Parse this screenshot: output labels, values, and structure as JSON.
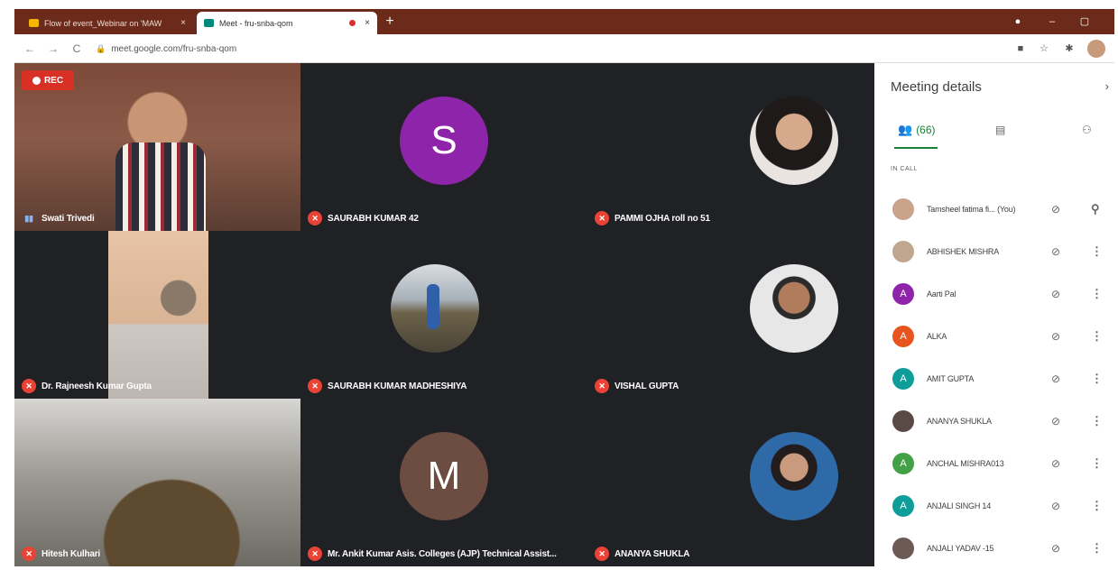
{
  "browser": {
    "tabs": [
      {
        "label": "Flow of event_Webinar on 'MAW",
        "active": false
      },
      {
        "label": "Meet - fru-snba-qom",
        "active": true
      }
    ],
    "tab_close": "×",
    "new_tab": "+",
    "url": "meet.google.com/fru-snba-qom",
    "nav": {
      "back": "←",
      "forward": "→",
      "reload": "C"
    },
    "window": {
      "minimize": "–",
      "maximize": "▢"
    },
    "toolbar_icons": [
      "camera-icon",
      "star-icon",
      "extensions-icon"
    ]
  },
  "meet": {
    "recording_label": "REC",
    "tiles": [
      {
        "name": "Swati Trivedi",
        "kind": "video",
        "muted": false
      },
      {
        "name": "SAURABH KUMAR 42",
        "kind": "letter",
        "letter": "S",
        "color": "#8e24aa",
        "muted": true
      },
      {
        "name": "PAMMI OJHA roll no 51",
        "kind": "photo",
        "muted": true
      },
      {
        "name": "Dr. Rajneesh Kumar Gupta",
        "kind": "video",
        "muted": true
      },
      {
        "name": "SAURABH KUMAR MADHESHIYA",
        "kind": "photo",
        "muted": true
      },
      {
        "name": "VISHAL GUPTA",
        "kind": "photo",
        "muted": true
      },
      {
        "name": "Hitesh Kulhari",
        "kind": "video",
        "muted": true
      },
      {
        "name": "Mr. Ankit Kumar Asis. Colleges (AJP) Technical Assist...",
        "kind": "letter",
        "letter": "M",
        "color": "#6d4c41",
        "muted": true
      },
      {
        "name": "ANANYA SHUKLA",
        "kind": "photo",
        "muted": true
      }
    ]
  },
  "panel": {
    "title": "Meeting details",
    "close": "›",
    "people_tab_label": "(66)",
    "in_call_label": "IN CALL",
    "participants": [
      {
        "name": "Tamsheel fatima fi... (You)",
        "avatar": "photo",
        "color": "#c9a28a",
        "letter": "",
        "action": "pin"
      },
      {
        "name": "ABHISHEK MISHRA",
        "avatar": "photo",
        "color": "#bfa78f",
        "letter": "",
        "action": "more"
      },
      {
        "name": "Aarti Pal",
        "avatar": "letter",
        "color": "#8e24aa",
        "letter": "A",
        "action": "more"
      },
      {
        "name": "ALKA",
        "avatar": "letter",
        "color": "#e8541e",
        "letter": "A",
        "action": "more"
      },
      {
        "name": "AMIT GUPTA",
        "avatar": "letter",
        "color": "#0f9d9a",
        "letter": "A",
        "action": "more"
      },
      {
        "name": "ANANYA SHUKLA",
        "avatar": "photo",
        "color": "#5a4a45",
        "letter": "",
        "action": "more"
      },
      {
        "name": "ANCHAL MISHRA013",
        "avatar": "letter",
        "color": "#43a047",
        "letter": "A",
        "action": "more"
      },
      {
        "name": "ANJALI SINGH 14",
        "avatar": "letter",
        "color": "#0f9d9a",
        "letter": "A",
        "action": "more"
      },
      {
        "name": "ANJALI YADAV -15",
        "avatar": "photo",
        "color": "#6e5a55",
        "letter": "",
        "action": "more"
      }
    ]
  }
}
